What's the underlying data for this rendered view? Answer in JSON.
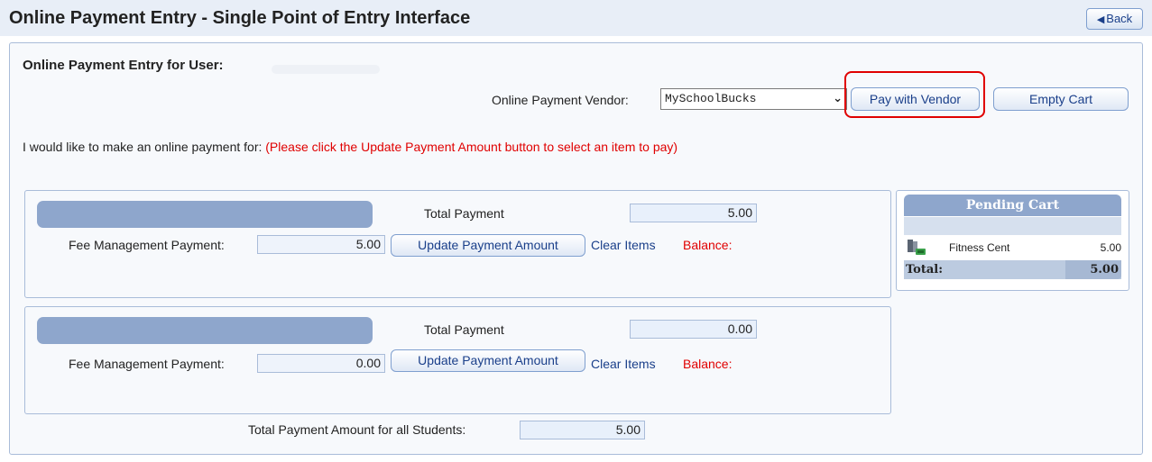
{
  "header": {
    "title": "Online Payment Entry - Single Point of Entry Interface",
    "back_label": "Back",
    "back_icon": "triangle-left-icon"
  },
  "panel": {
    "subtitle": "Online Payment Entry for User:",
    "vendor_label": "Online Payment Vendor:",
    "vendor_value": "MySchoolBucks",
    "pay_button": "Pay with Vendor",
    "empty_button": "Empty Cart",
    "intro_text": "I would like to make an online payment for:",
    "intro_warning": "(Please click the Update Payment Amount button to select an item to pay)"
  },
  "students": [
    {
      "total_label": "Total Payment",
      "total_value": "5.00",
      "fee_label": "Fee Management Payment:",
      "fee_value": "5.00",
      "update_button": "Update Payment Amount",
      "clear_link": "Clear Items",
      "balance_label": "Balance:"
    },
    {
      "total_label": "Total Payment",
      "total_value": "0.00",
      "fee_label": "Fee Management Payment:",
      "fee_value": "0.00",
      "update_button": "Update Payment Amount",
      "clear_link": "Clear Items",
      "balance_label": "Balance:"
    }
  ],
  "cart": {
    "title": "Pending Cart",
    "items": [
      {
        "name": "Fitness Cent",
        "amount": "5.00",
        "icon": "fitness-item-icon"
      }
    ],
    "total_label": "Total:",
    "total_value": "5.00"
  },
  "footer": {
    "grand_total_label": "Total Payment Amount for all Students:",
    "grand_total_value": "5.00"
  },
  "colors": {
    "accent": "#1a3f8a",
    "warning": "#e00000",
    "name_bar": "#8ea6cc",
    "highlight": "#e00000"
  }
}
